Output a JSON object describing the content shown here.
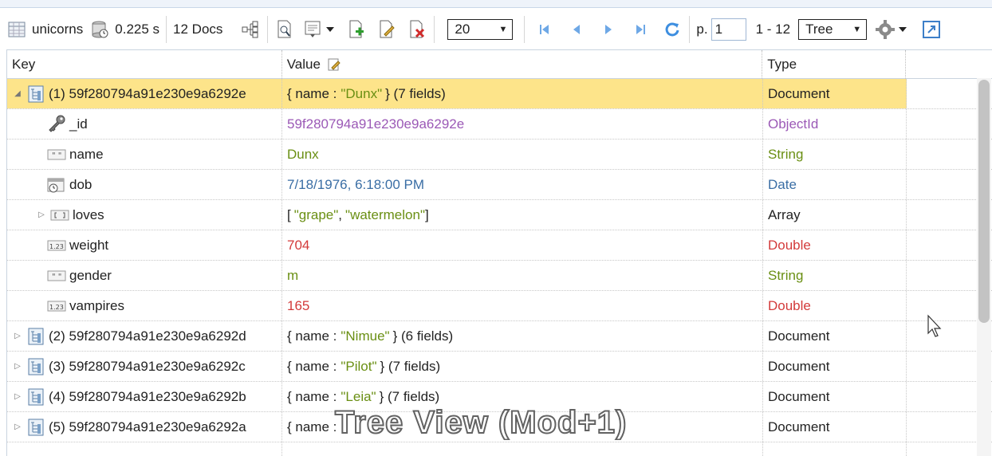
{
  "toolbar": {
    "collection": "unicorns",
    "time": "0.225 s",
    "docs": "12 Docs",
    "page_size": "20",
    "page_label": "p.",
    "page_value": "1",
    "range": "1 - 12",
    "view_mode": "Tree"
  },
  "columns": {
    "key": "Key",
    "value": "Value",
    "type": "Type"
  },
  "rows": [
    {
      "key": "(1) 59f280794a91e230e9a6292e",
      "value_prefix": "{ name : ",
      "value_str": "\"Dunx\"",
      "value_suffix": " } (7 fields)",
      "type": "Document"
    },
    {
      "key": "_id",
      "value": "59f280794a91e230e9a6292e",
      "type": "ObjectId"
    },
    {
      "key": "name",
      "value": "Dunx",
      "type": "String"
    },
    {
      "key": "dob",
      "value": "7/18/1976, 6:18:00 PM",
      "type": "Date"
    },
    {
      "key": "loves",
      "value_a": "[ ",
      "value_b": "\"grape\"",
      "value_c": ", ",
      "value_d": "\"watermelon\"",
      "value_e": " ]",
      "type": "Array"
    },
    {
      "key": "weight",
      "value": "704",
      "type": "Double"
    },
    {
      "key": "gender",
      "value": "m",
      "type": "String"
    },
    {
      "key": "vampires",
      "value": "165",
      "type": "Double"
    },
    {
      "key": "(2) 59f280794a91e230e9a6292d",
      "value_prefix": "{ name : ",
      "value_str": "\"Nimue\"",
      "value_suffix": " } (6 fields)",
      "type": "Document"
    },
    {
      "key": "(3) 59f280794a91e230e9a6292c",
      "value_prefix": "{ name : ",
      "value_str": "\"Pilot\"",
      "value_suffix": " } (7 fields)",
      "type": "Document"
    },
    {
      "key": "(4) 59f280794a91e230e9a6292b",
      "value_prefix": "{ name : ",
      "value_str": "\"Leia\"",
      "value_suffix": " } (7 fields)",
      "type": "Document"
    },
    {
      "key": "(5) 59f280794a91e230e9a6292a",
      "value_prefix": "{ name : ",
      "type": "Document"
    }
  ],
  "overlay_caption": "Tree View (Mod+1)",
  "colors": {
    "selected_row": "#fde48a",
    "string": "#6a8f13",
    "objectid": "#9b59b6",
    "date": "#3a6ea5",
    "number": "#d33a3a"
  }
}
